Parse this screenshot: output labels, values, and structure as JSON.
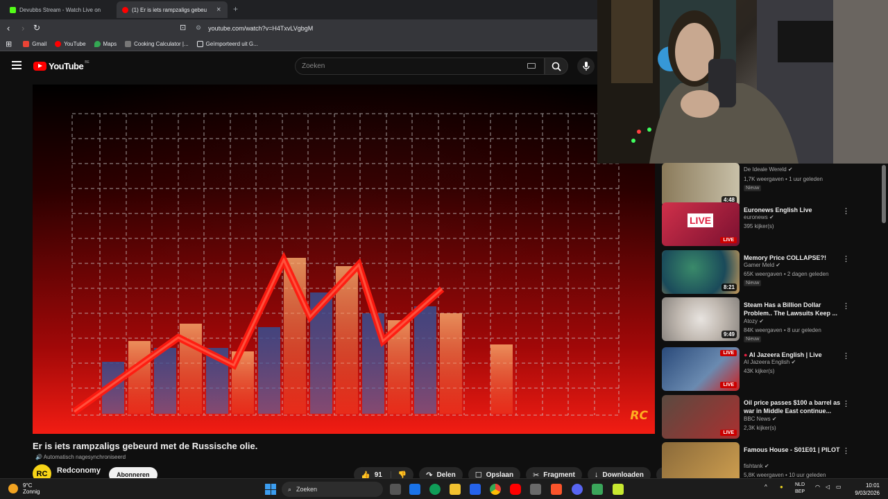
{
  "browser": {
    "tabs": [
      {
        "title": "Devubbs Stream - Watch Live on",
        "active": false,
        "favicon_color": "#53fc18"
      },
      {
        "title": "(1) Er is iets rampzaligs gebeu",
        "active": true,
        "favicon_color": "#ff0000"
      }
    ],
    "url": "youtube.com/watch?v=H4TxvLVgbgM",
    "bookmarks": [
      {
        "label": "Gmail",
        "color": "#ea4335"
      },
      {
        "label": "YouTube",
        "color": "#ff0000"
      },
      {
        "label": "Maps",
        "color": "#34a853"
      },
      {
        "label": "Cooking Calculator |...",
        "color": "#777777"
      },
      {
        "label": "Geïmporteerd uit G...",
        "color": "#e8eaed"
      }
    ]
  },
  "youtube": {
    "logo_text": "YouTube",
    "country_code": "BE",
    "search_placeholder": "Zoeken"
  },
  "video": {
    "title": "Er is iets rampzaligs gebeurd met de Russische olie.",
    "subtitle_note": "Automatisch nagesynchroniseerd",
    "channel_initials": "RC",
    "channel_name": "Redconomy",
    "subscribe_label": "Abonneren",
    "likes": "91",
    "share_label": "Delen",
    "save_label": "Opslaan",
    "clip_label": "Fragment",
    "download_label": "Downloaden",
    "watermark": "RC"
  },
  "recommendations": [
    {
      "title": "",
      "channel": "De Ideale Wereld",
      "meta": "1,7K weergaven • 1 uur geleden",
      "badge": "Nieuw",
      "duration": "4:48",
      "live": false,
      "thumb_colors": [
        "#8a7a5a",
        "#c8c0a8"
      ]
    },
    {
      "title": "Euronews English Live",
      "channel": "euronews",
      "meta": "395 kijker(s)",
      "badge": "",
      "duration": "",
      "live": true,
      "thumb_colors": [
        "#d0304a",
        "#7a1030"
      ]
    },
    {
      "title": "Memory Price COLLAPSE?!",
      "channel": "Gamer Meld",
      "meta": "65K weergaven • 2 dagen geleden",
      "badge": "Nieuw",
      "duration": "8:21",
      "live": false,
      "thumb_colors": [
        "#3a8a6a",
        "#c89a5a"
      ]
    },
    {
      "title": "Steam Has a Billion Dollar Problem.. The Lawsuits Keep ...",
      "channel": "Atozy",
      "meta": "84K weergaven • 8 uur geleden",
      "badge": "Nieuw",
      "duration": "9:49",
      "live": false,
      "thumb_colors": [
        "#c0b8b0",
        "#e8e4e0"
      ]
    },
    {
      "title": "Al Jazeera English | Live",
      "channel": "Al Jazeera English",
      "meta": "43K kijker(s)",
      "badge": "",
      "duration": "",
      "live": true,
      "thumb_colors": [
        "#2a4a7a",
        "#6a8ab0"
      ]
    },
    {
      "title": "Oil price passes $100 a barrel as war in Middle East continue...",
      "channel": "BBC News",
      "meta": "2,3K kijker(s)",
      "badge": "",
      "duration": "",
      "live": true,
      "thumb_colors": [
        "#5a4a40",
        "#aa3030"
      ]
    },
    {
      "title": "Famous House - S01E01 | PILOT",
      "channel": "fishtank",
      "meta": "5,8K weergaven • 10 uur geleden",
      "badge": "",
      "duration": "",
      "live": false,
      "thumb_colors": [
        "#8a6a3a",
        "#d0a050"
      ]
    }
  ],
  "live_label": "LIVE",
  "taskbar": {
    "temperature": "9°C",
    "weather": "Zonnig",
    "search_label": "Zoeken",
    "lang_line1": "NLD",
    "lang_line2": "BEP",
    "time": "10:01",
    "date": "9/03/2026"
  }
}
